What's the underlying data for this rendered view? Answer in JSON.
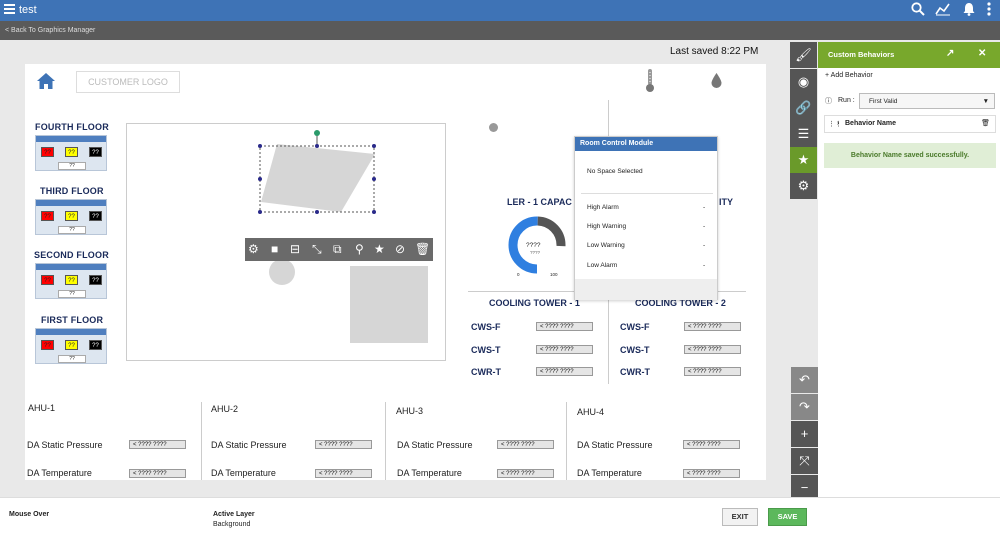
{
  "app": {
    "title": "test",
    "back_link": "< Back To Graphics Manager",
    "last_saved": "Last saved 8:22 PM"
  },
  "canvas": {
    "logo_text": "CUSTOMER LOGO",
    "floors": [
      {
        "label": "FOURTH FLOOR",
        "swatches": [
          "??",
          "??",
          "??"
        ],
        "sub": "??"
      },
      {
        "label": "THIRD FLOOR",
        "swatches": [
          "??",
          "??",
          "??"
        ],
        "sub": "??"
      },
      {
        "label": "SECOND FLOOR",
        "swatches": [
          "??",
          "??",
          "??"
        ],
        "sub": "??"
      },
      {
        "label": "FIRST FLOOR",
        "swatches": [
          "??",
          "??",
          "??"
        ],
        "sub": "??"
      }
    ],
    "gauge": {
      "title_left": "LER - 1 CAPAC",
      "title_right": "ITY",
      "value": "????",
      "sub": "????",
      "min": "0",
      "max": "100"
    },
    "cooling_towers": [
      {
        "title": "COOLING TOWER - 1",
        "rows": [
          {
            "label": "CWS-F",
            "value": "< ???? ????"
          },
          {
            "label": "CWS-T",
            "value": "< ???? ????"
          },
          {
            "label": "CWR-T",
            "value": "< ???? ????"
          }
        ]
      },
      {
        "title": "COOLING TOWER - 2",
        "rows": [
          {
            "label": "CWS-F",
            "value": "< ???? ????"
          },
          {
            "label": "CWS-T",
            "value": "< ???? ????"
          },
          {
            "label": "CWR-T",
            "value": "< ???? ????"
          }
        ]
      }
    ],
    "ahus": [
      {
        "title": "AHU-1",
        "rows": [
          {
            "label": "DA Static Pressure",
            "value": "< ???? ????"
          },
          {
            "label": "DA Temperature",
            "value": "< ???? ????"
          }
        ]
      },
      {
        "title": "AHU-2",
        "rows": [
          {
            "label": "DA Static Pressure",
            "value": "< ???? ????"
          },
          {
            "label": "DA Temperature",
            "value": "< ???? ????"
          }
        ]
      },
      {
        "title": "AHU-3",
        "rows": [
          {
            "label": "DA Static Pressure",
            "value": "< ???? ????"
          },
          {
            "label": "DA Temperature",
            "value": "< ???? ????"
          }
        ]
      },
      {
        "title": "AHU-4",
        "rows": [
          {
            "label": "DA Static Pressure",
            "value": "< ???? ????"
          },
          {
            "label": "DA Temperature",
            "value": "< ???? ????"
          }
        ]
      }
    ]
  },
  "popup": {
    "title": "Room Control Module",
    "no_space": "No Space Selected",
    "rows": [
      {
        "label": "High Alarm",
        "value": "-"
      },
      {
        "label": "High Warning",
        "value": "-"
      },
      {
        "label": "Low Warning",
        "value": "-"
      },
      {
        "label": "Low Alarm",
        "value": "-"
      }
    ]
  },
  "panel": {
    "title": "Custom Behaviors",
    "add_behavior": "Add Behavior",
    "run_label": "Run :",
    "run_value": "First Valid",
    "behavior_name": "Behavior Name",
    "success": "Behavior Name  saved successfully."
  },
  "bottom": {
    "mouse_over": "Mouse Over",
    "active_layer_label": "Active Layer",
    "active_layer_value": "Background",
    "exit": "EXIT",
    "save": "SAVE"
  },
  "colors": {
    "brand": "#3e73b6",
    "panel_header": "#78a82c",
    "save_button": "#5cb85c",
    "swatch_red": "#ff0000",
    "swatch_yellow": "#ffff00",
    "swatch_black": "#000000"
  },
  "icons": [
    "menu-icon",
    "search-icon",
    "trend-icon",
    "bell-icon",
    "more-icon",
    "home-icon",
    "thermometer-icon",
    "droplet-icon",
    "paintbrush-icon",
    "tag-icon",
    "link-icon",
    "layers-icon",
    "star-gear-icon",
    "gear-icon",
    "undo-icon",
    "redo-icon",
    "zoom-in-icon",
    "fit-icon",
    "zoom-out-icon"
  ]
}
